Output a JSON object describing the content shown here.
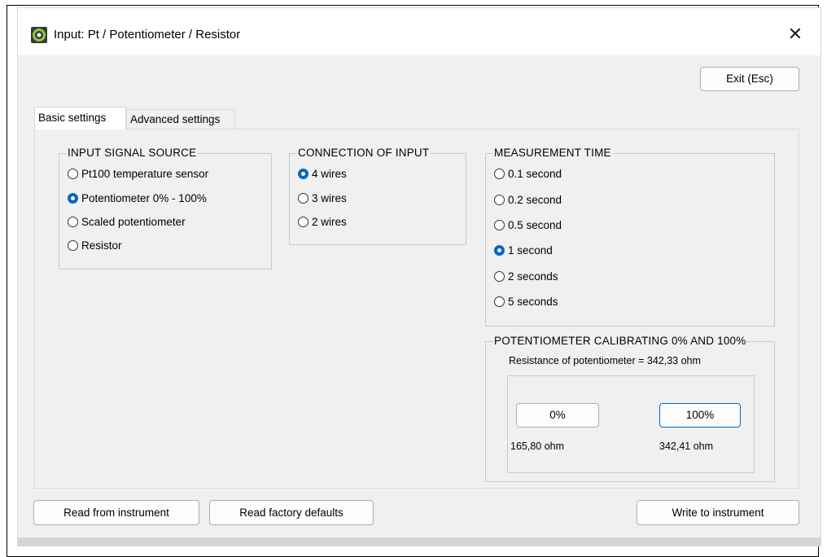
{
  "window": {
    "title": "Input: Pt / Potentiometer / Resistor",
    "close_symbol": "✕"
  },
  "toolbar": {
    "exit_label": "Exit (Esc)"
  },
  "tabs": [
    {
      "label": "Basic settings",
      "active": true
    },
    {
      "label": "Advanced settings",
      "active": false
    }
  ],
  "input_signal_source": {
    "title": "INPUT SIGNAL SOURCE",
    "options": [
      {
        "label": "Pt100 temperature sensor",
        "selected": false
      },
      {
        "label": "Potentiometer 0% - 100%",
        "selected": true
      },
      {
        "label": "Scaled potentiometer",
        "selected": false
      },
      {
        "label": "Resistor",
        "selected": false
      }
    ]
  },
  "connection_of_input": {
    "title": "CONNECTION OF INPUT",
    "options": [
      {
        "label": "4 wires",
        "selected": true
      },
      {
        "label": "3 wires",
        "selected": false
      },
      {
        "label": "2 wires",
        "selected": false
      }
    ]
  },
  "measurement_time": {
    "title": "MEASUREMENT TIME",
    "options": [
      {
        "label": "0.1 second",
        "selected": false
      },
      {
        "label": "0.2 second",
        "selected": false
      },
      {
        "label": "0.5 second",
        "selected": false
      },
      {
        "label": "1 second",
        "selected": true
      },
      {
        "label": "2 seconds",
        "selected": false
      },
      {
        "label": "5 seconds",
        "selected": false
      }
    ]
  },
  "calibration": {
    "title": "POTENTIOMETER CALIBRATING 0% AND 100%",
    "resistance_text": "Resistance of potentiometer = 342,33 ohm",
    "zero_label": "0%",
    "zero_value": "165,80 ohm",
    "full_label": "100%",
    "full_value": "342,41 ohm"
  },
  "footer": {
    "read_instrument": "Read from instrument",
    "read_defaults": "Read factory defaults",
    "write_instrument": "Write to instrument"
  },
  "colors": {
    "accent": "#0067c0",
    "window_bg": "#f0f0f0"
  }
}
